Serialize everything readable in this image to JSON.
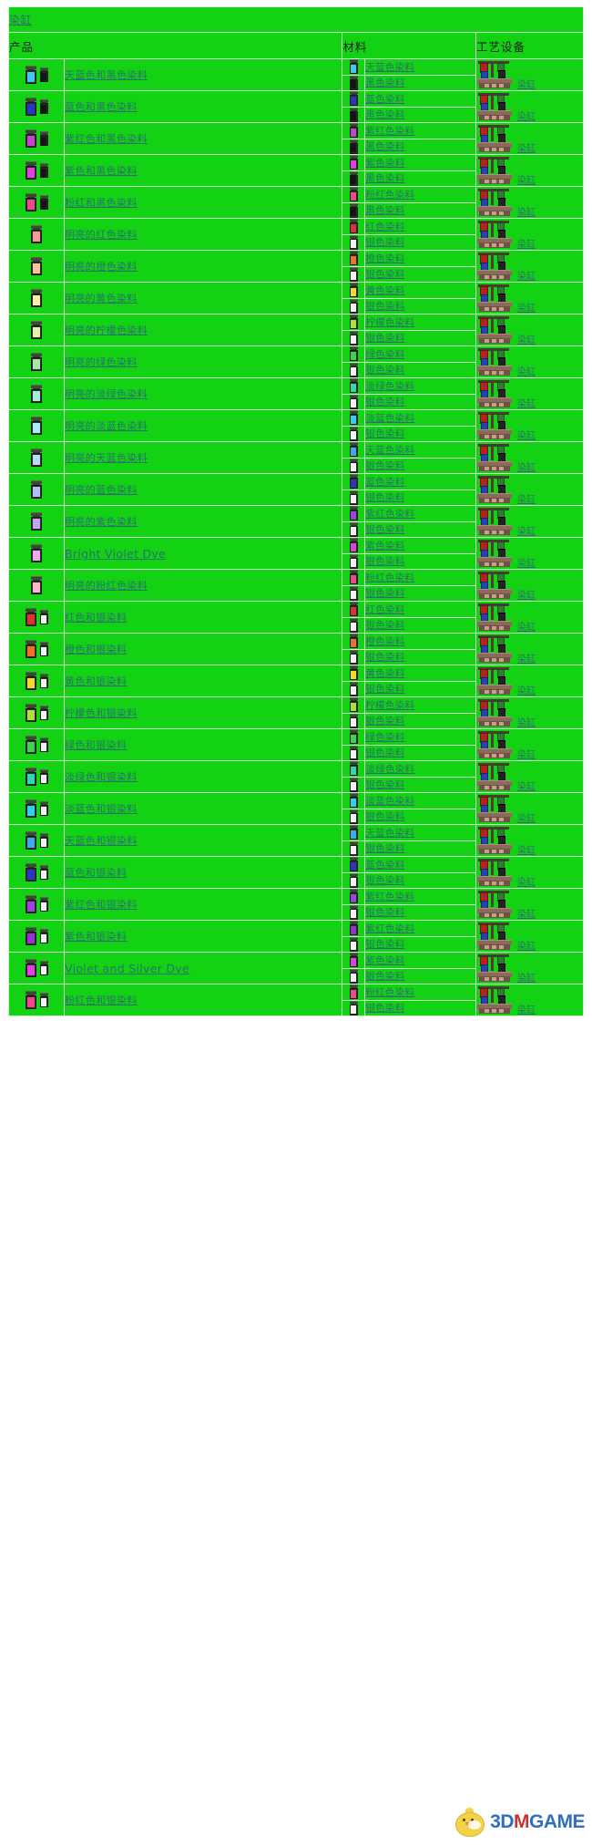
{
  "page": {
    "background_color": "#FFFFFF",
    "table_background_color": "#13D213",
    "link_color": "#2A7070",
    "border_color": "#C9F5C9"
  },
  "title": {
    "label": "染缸"
  },
  "columns": {
    "product": "产品",
    "materials": "材料",
    "station": "工艺设备"
  },
  "station": {
    "label": "染缸",
    "icon": "dye-vat-icon"
  },
  "watermark": {
    "part1": "3D",
    "part2": "M",
    "part3": "GAME",
    "icon": "chick-logo-icon"
  },
  "rows": [
    {
      "product": "天蓝色和黑色染料",
      "product_icons": [
        "#3FC8F0",
        "#141414"
      ],
      "materials": [
        {
          "name": "天蓝色染料",
          "color": "#3FC8F0"
        },
        {
          "name": "黑色染料",
          "color": "#141414"
        }
      ]
    },
    {
      "product": "蓝色和黑色染料",
      "product_icons": [
        "#2B34C8",
        "#141414"
      ],
      "materials": [
        {
          "name": "蓝色染料",
          "color": "#2B34C8"
        },
        {
          "name": "黑色染料",
          "color": "#141414"
        }
      ]
    },
    {
      "product": "紫红色和黑色染料",
      "product_icons": [
        "#C83FD2",
        "#141414"
      ],
      "materials": [
        {
          "name": "紫红色染料",
          "color": "#C83FD2"
        },
        {
          "name": "黑色染料",
          "color": "#141414"
        }
      ]
    },
    {
      "product": "紫色和黑色染料",
      "product_icons": [
        "#E040E0",
        "#141414"
      ],
      "materials": [
        {
          "name": "紫色染料",
          "color": "#E040E0"
        },
        {
          "name": "黑色染料",
          "color": "#141414"
        }
      ]
    },
    {
      "product": "粉红和黑色染料",
      "product_icons": [
        "#F0468C",
        "#141414"
      ],
      "materials": [
        {
          "name": "粉红色染料",
          "color": "#F0468C"
        },
        {
          "name": "黑色染料",
          "color": "#141414"
        }
      ]
    },
    {
      "product": "明亮的红色染料",
      "product_icons": [
        "#F59898"
      ],
      "materials": [
        {
          "name": "红色染料",
          "color": "#E03030"
        },
        {
          "name": "银色染料",
          "color": "#F2F2F2"
        }
      ]
    },
    {
      "product": "明亮的橙色染料",
      "product_icons": [
        "#F8C49A"
      ],
      "materials": [
        {
          "name": "橙色染料",
          "color": "#F07028"
        },
        {
          "name": "银色染料",
          "color": "#F2F2F2"
        }
      ]
    },
    {
      "product": "明亮的黄色染料",
      "product_icons": [
        "#F8EDA8"
      ],
      "materials": [
        {
          "name": "黄色染料",
          "color": "#F5D828"
        },
        {
          "name": "银色染料",
          "color": "#F2F2F2"
        }
      ]
    },
    {
      "product": "明亮的柠檬色染料",
      "product_icons": [
        "#E2F0A8"
      ],
      "materials": [
        {
          "name": "柠檬色染料",
          "color": "#AEE038"
        },
        {
          "name": "银色染料",
          "color": "#F2F2F2"
        }
      ]
    },
    {
      "product": "明亮的绿色染料",
      "product_icons": [
        "#A8E8A8"
      ],
      "materials": [
        {
          "name": "绿色染料",
          "color": "#3FD34F"
        },
        {
          "name": "银色染料",
          "color": "#F2F2F2"
        }
      ]
    },
    {
      "product": "明亮的淡绿色染料",
      "product_icons": [
        "#A8EDD8"
      ],
      "materials": [
        {
          "name": "淡绿色染料",
          "color": "#2FD8B0"
        },
        {
          "name": "银色染料",
          "color": "#F2F2F2"
        }
      ]
    },
    {
      "product": "明亮的淡蓝色染料",
      "product_icons": [
        "#A8EAF8"
      ],
      "materials": [
        {
          "name": "淡蓝色染料",
          "color": "#2FD0F5"
        },
        {
          "name": "银色染料",
          "color": "#F2F2F2"
        }
      ]
    },
    {
      "product": "明亮的天蓝色染料",
      "product_icons": [
        "#B8DCF8"
      ],
      "materials": [
        {
          "name": "天蓝色染料",
          "color": "#3FA8F0"
        },
        {
          "name": "银色染料",
          "color": "#F2F2F2"
        }
      ]
    },
    {
      "product": "明亮的蓝色染料",
      "product_icons": [
        "#B0BEF5"
      ],
      "materials": [
        {
          "name": "蓝色染料",
          "color": "#2B34C8"
        },
        {
          "name": "银色染料",
          "color": "#F2F2F2"
        }
      ]
    },
    {
      "product": "明亮的紫色染料",
      "product_icons": [
        "#C2A8F0"
      ],
      "materials": [
        {
          "name": "紫红色染料",
          "color": "#A040E0"
        },
        {
          "name": "银色染料",
          "color": "#F2F2F2"
        }
      ]
    },
    {
      "product": "Bright Violet Dye",
      "product_icons": [
        "#EDA8ED"
      ],
      "english": true,
      "materials": [
        {
          "name": "紫色染料",
          "color": "#E040E0"
        },
        {
          "name": "银色染料",
          "color": "#F2F2F2"
        }
      ]
    },
    {
      "product": "明亮的粉红色染料",
      "product_icons": [
        "#F8B8C8"
      ],
      "materials": [
        {
          "name": "粉红色染料",
          "color": "#F0468C"
        },
        {
          "name": "银色染料",
          "color": "#F2F2F2"
        }
      ]
    },
    {
      "product": "红色和银染料",
      "product_icons": [
        "#E03030",
        "#F2F2F2"
      ],
      "materials": [
        {
          "name": "红色染料",
          "color": "#E03030"
        },
        {
          "name": "银色染料",
          "color": "#F2F2F2"
        }
      ]
    },
    {
      "product": "橙色和银染料",
      "product_icons": [
        "#F07028",
        "#F2F2F2"
      ],
      "materials": [
        {
          "name": "橙色染料",
          "color": "#F07028"
        },
        {
          "name": "银色染料",
          "color": "#F2F2F2"
        }
      ]
    },
    {
      "product": "黄色和银染料",
      "product_icons": [
        "#F5D828",
        "#F2F2F2"
      ],
      "materials": [
        {
          "name": "黄色染料",
          "color": "#F5D828"
        },
        {
          "name": "银色染料",
          "color": "#F2F2F2"
        }
      ]
    },
    {
      "product": "柠檬色和银染料",
      "product_icons": [
        "#AEE038",
        "#F2F2F2"
      ],
      "materials": [
        {
          "name": "柠檬色染料",
          "color": "#AEE038"
        },
        {
          "name": "银色染料",
          "color": "#F2F2F2"
        }
      ]
    },
    {
      "product": "绿色和银染料",
      "product_icons": [
        "#3FD34F",
        "#F2F2F2"
      ],
      "materials": [
        {
          "name": "绿色染料",
          "color": "#3FD34F"
        },
        {
          "name": "银色染料",
          "color": "#F2F2F2"
        }
      ]
    },
    {
      "product": "淡绿色和银染料",
      "product_icons": [
        "#2FD8B0",
        "#F2F2F2"
      ],
      "materials": [
        {
          "name": "淡绿色染料",
          "color": "#2FD8B0"
        },
        {
          "name": "银色染料",
          "color": "#F2F2F2"
        }
      ]
    },
    {
      "product": "淡蓝色和银染料",
      "product_icons": [
        "#2FD0F5",
        "#F2F2F2"
      ],
      "materials": [
        {
          "name": "淡蓝色染料",
          "color": "#2FD0F5"
        },
        {
          "name": "银色染料",
          "color": "#F2F2F2"
        }
      ]
    },
    {
      "product": "天蓝色和银染料",
      "product_icons": [
        "#3FA8F0",
        "#F2F2F2"
      ],
      "materials": [
        {
          "name": "天蓝色染料",
          "color": "#3FA8F0"
        },
        {
          "name": "银色染料",
          "color": "#F2F2F2"
        }
      ]
    },
    {
      "product": "蓝色和银染料",
      "product_icons": [
        "#2B34C8",
        "#F2F2F2"
      ],
      "materials": [
        {
          "name": "蓝色染料",
          "color": "#2B34C8"
        },
        {
          "name": "银色染料",
          "color": "#F2F2F2"
        }
      ]
    },
    {
      "product": "紫红色和银染料",
      "product_icons": [
        "#A040E0",
        "#F2F2F2"
      ],
      "materials": [
        {
          "name": "紫红色染料",
          "color": "#A040E0"
        },
        {
          "name": "银色染料",
          "color": "#F2F2F2"
        }
      ]
    },
    {
      "product": "紫色和银染料",
      "product_icons": [
        "#9B30D0",
        "#F2F2F2"
      ],
      "materials": [
        {
          "name": "紫红色染料",
          "color": "#9B30D0"
        },
        {
          "name": "银色染料",
          "color": "#F2F2F2"
        }
      ]
    },
    {
      "product": "Violet and Silver Dye",
      "product_icons": [
        "#E040E0",
        "#F2F2F2"
      ],
      "english": true,
      "materials": [
        {
          "name": "紫色染料",
          "color": "#E040E0"
        },
        {
          "name": "银色染料",
          "color": "#F2F2F2"
        }
      ]
    },
    {
      "product": "粉红色和银染料",
      "product_icons": [
        "#F0468C",
        "#F2F2F2"
      ],
      "materials": [
        {
          "name": "粉红色染料",
          "color": "#F0468C"
        },
        {
          "name": "银色染料",
          "color": "#F2F2F2"
        }
      ]
    }
  ]
}
